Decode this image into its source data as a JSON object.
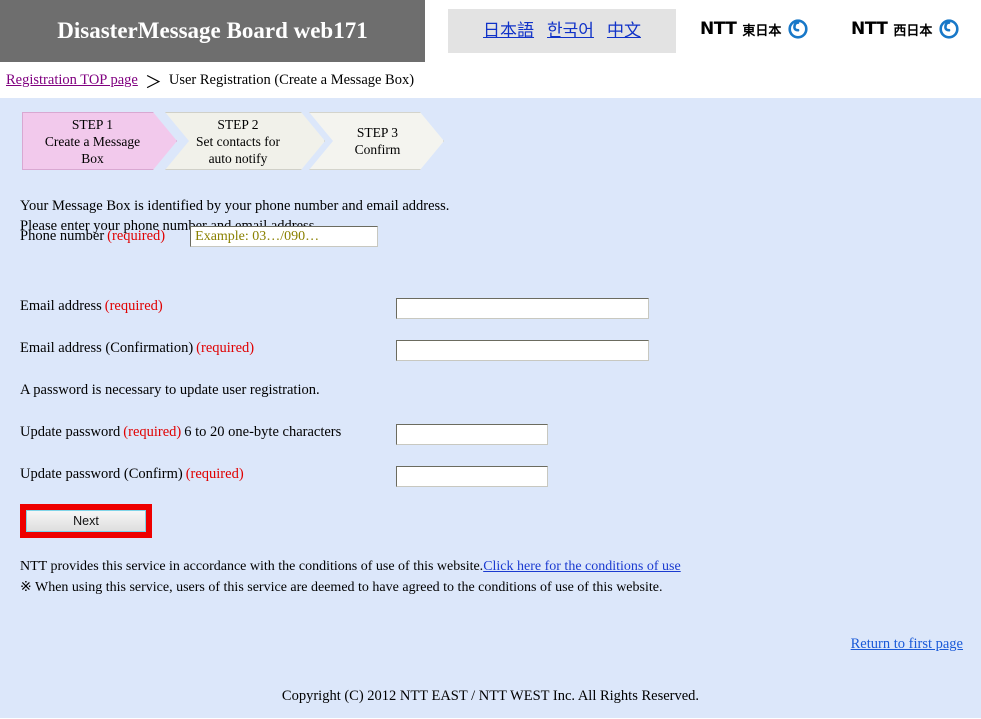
{
  "header": {
    "site_title": "DisasterMessage Board web171",
    "languages": [
      {
        "label": "日本語",
        "name": "lang-japanese"
      },
      {
        "label": "한국어",
        "name": "lang-korean"
      },
      {
        "label": "中文",
        "name": "lang-chinese"
      }
    ],
    "logos": [
      {
        "word": "NTT",
        "region": "東日本"
      },
      {
        "word": "NTT",
        "region": "西日本"
      }
    ]
  },
  "breadcrumb": {
    "home_link": "Registration TOP page",
    "separator": "＞",
    "current": "User Registration (Create a Message Box)"
  },
  "steps": [
    {
      "title": "STEP 1",
      "line1": "Create a Message",
      "line2": "Box",
      "active": true
    },
    {
      "title": "STEP 2",
      "line1": "Set contacts for",
      "line2": "auto notify",
      "active": false
    },
    {
      "title": "STEP 3",
      "line1": "Confirm",
      "line2": "",
      "active": false
    }
  ],
  "intro": {
    "line1": "Your Message Box is identified by your phone number and email address.",
    "line2": "Please enter your phone number and email address."
  },
  "form": {
    "required_tag": "(required)",
    "phone": {
      "label": "Phone number",
      "placeholder": "Example: 03…/090…",
      "value": ""
    },
    "email": {
      "label": "Email address",
      "value": ""
    },
    "email_confirm": {
      "label": "Email address (Confirmation)",
      "value": ""
    },
    "password_note": "A password is necessary to update user registration.",
    "password": {
      "label": "Update password",
      "hint": "6 to 20 one-byte characters",
      "value": ""
    },
    "password_confirm": {
      "label": "Update password (Confirm)",
      "value": ""
    },
    "next_button": "Next"
  },
  "legal": {
    "line1_text": "NTT provides this service in accordance with the conditions of use of this website.",
    "line1_link": "Click here for the conditions of use",
    "line2": "※ When using this service, users of this service are deemed to have agreed to the conditions of use of this website."
  },
  "return_link": "Return to first page",
  "copyright": "Copyright (C) 2012 NTT EAST / NTT WEST Inc. All Rights Reserved.",
  "colors": {
    "header_bar": "#6e6e6e",
    "panel_bg": "#dce7fa",
    "step_active": "#f2c9ec",
    "step_inactive": "#f1f1ea",
    "required_red": "#e00000",
    "annotation_red": "#ee0000",
    "crumb_link": "#800080",
    "link_blue": "#1a3ad0",
    "ntt_blue": "#1878c8",
    "placeholder": "#8a8000"
  }
}
